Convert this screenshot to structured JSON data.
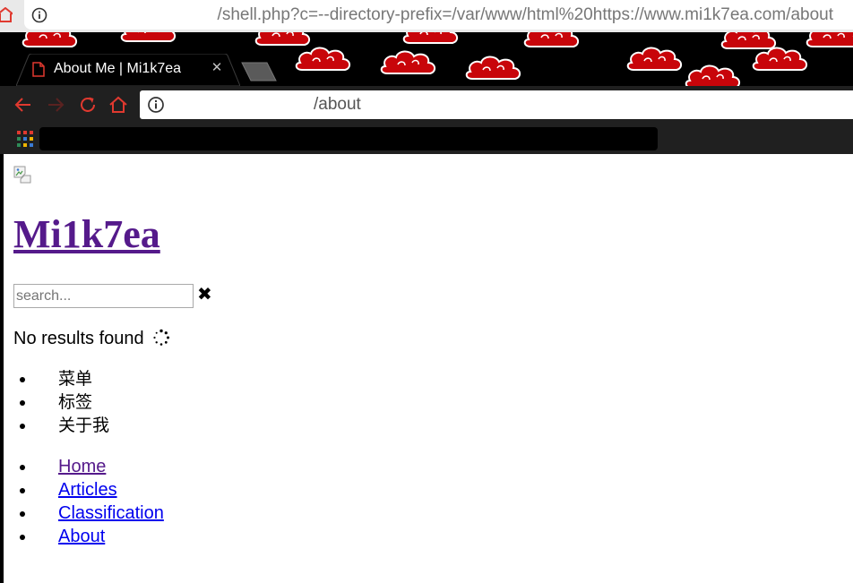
{
  "outer_browser": {
    "url": "/shell.php?c=--directory-prefix=/var/www/html%20https://www.mi1k7ea.com/about"
  },
  "browser": {
    "tab": {
      "title": "About Me | Mi1k7ea",
      "close_label": "✕"
    },
    "address": "/about",
    "theme_colors": {
      "frame": "#000000",
      "toolbar": "#202020",
      "accent": "#e0392f"
    }
  },
  "page": {
    "site_title": "Mi1k7ea",
    "search": {
      "placeholder": "search...",
      "value": "",
      "clear_label": "✖"
    },
    "no_results": "No results found",
    "menu_items": [
      {
        "label": "菜单"
      },
      {
        "label": "标签"
      },
      {
        "label": "关于我"
      }
    ],
    "nav_links": [
      {
        "label": "Home",
        "visited": true
      },
      {
        "label": "Articles",
        "visited": false
      },
      {
        "label": "Classification",
        "visited": false
      },
      {
        "label": "About",
        "visited": false
      }
    ],
    "colors": {
      "visited_link": "#551a8b",
      "link": "#0000ee"
    }
  }
}
